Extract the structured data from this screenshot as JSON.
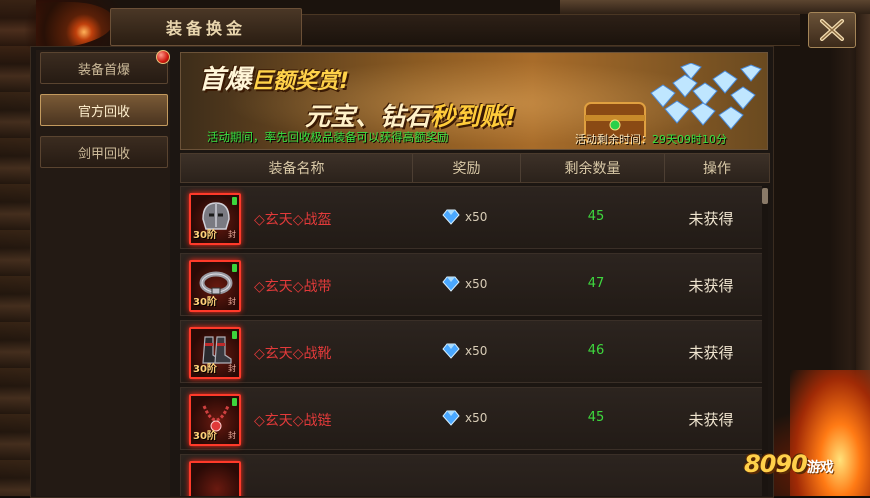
{
  "window": {
    "title": "装备换金"
  },
  "sidebar": {
    "items": [
      {
        "label": "装备首爆",
        "active": false,
        "has_badge": true
      },
      {
        "label": "官方回收",
        "active": true,
        "has_badge": false
      },
      {
        "label": "剑甲回收",
        "active": false,
        "has_badge": false
      }
    ]
  },
  "banner": {
    "line1_a": "首爆",
    "line1_b": "巨额奖赏!",
    "line2_a": "元宝、钻石",
    "line2_b": "秒到账!",
    "note": "活动期间，率先回收极品装备可以获得高额奖励",
    "countdown_label": "活动剩余时间：",
    "countdown_value": "29天09时10分"
  },
  "table": {
    "headers": [
      "装备名称",
      "奖励",
      "剩余数量",
      "操作"
    ],
    "rows": [
      {
        "tier": "30阶",
        "seal": "封",
        "name": "◇玄天◇战盔",
        "reward": "x50",
        "remaining": "45",
        "action": "未获得",
        "icon": "helmet-icon"
      },
      {
        "tier": "30阶",
        "seal": "封",
        "name": "◇玄天◇战带",
        "reward": "x50",
        "remaining": "47",
        "action": "未获得",
        "icon": "belt-icon"
      },
      {
        "tier": "30阶",
        "seal": "封",
        "name": "◇玄天◇战靴",
        "reward": "x50",
        "remaining": "46",
        "action": "未获得",
        "icon": "boots-icon"
      },
      {
        "tier": "30阶",
        "seal": "封",
        "name": "◇玄天◇战链",
        "reward": "x50",
        "remaining": "45",
        "action": "未获得",
        "icon": "necklace-icon"
      }
    ]
  },
  "watermark": {
    "brand": "8090",
    "suffix": "游戏"
  },
  "colors": {
    "item_name": "#e23a3a",
    "remaining": "#3ed83e",
    "note": "#38e040",
    "gem": "#4aa8ff"
  }
}
